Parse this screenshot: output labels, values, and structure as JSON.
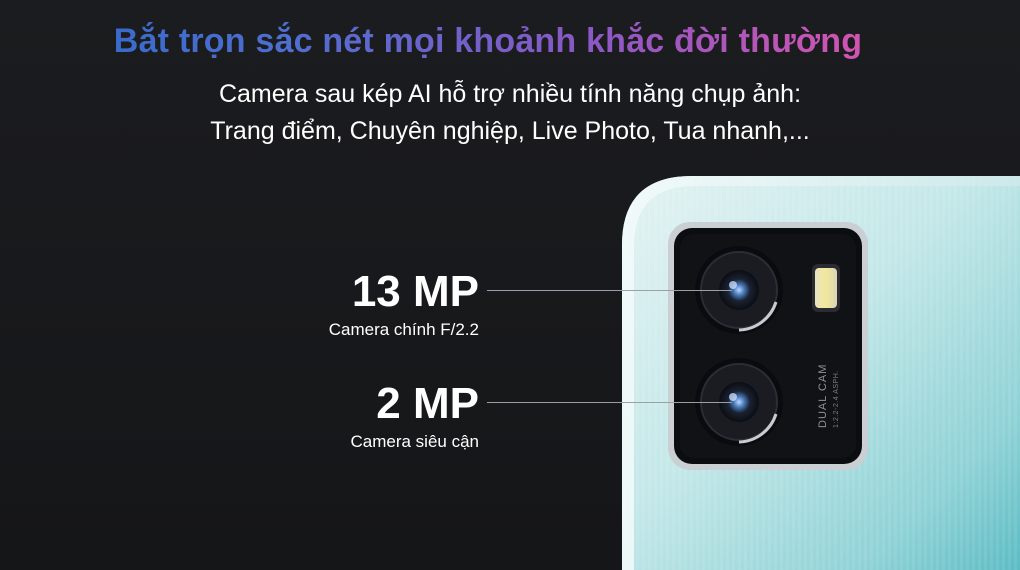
{
  "headline": "Bắt trọn sắc nét mọi khoảnh khắc đời thường",
  "subline": {
    "line1": "Camera sau kép AI hỗ trợ nhiều tính năng chụp ảnh:",
    "line2": "Trang điểm, Chuyên nghiệp, Live Photo, Tua nhanh,..."
  },
  "cameras": [
    {
      "resolution": "13 MP",
      "description": "Camera chính F/2.2"
    },
    {
      "resolution": "2 MP",
      "description": "Camera siêu cận"
    }
  ],
  "module_text": {
    "line1": "DUAL CAM",
    "line2": "1:2.2-2.4 ASPH."
  },
  "colors": {
    "background": "#1b1c1f",
    "phone_body": "#bfe6e8",
    "headline_start": "#2c68c9",
    "headline_end": "#e15aa6"
  }
}
